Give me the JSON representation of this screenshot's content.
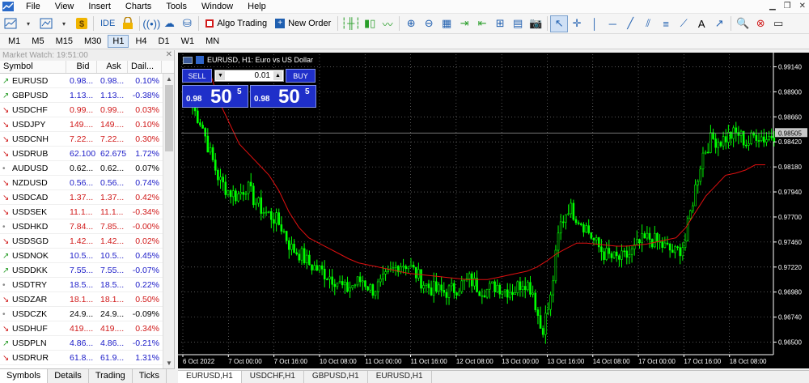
{
  "menu": [
    "File",
    "View",
    "Insert",
    "Charts",
    "Tools",
    "Window",
    "Help"
  ],
  "toolbar": {
    "ide_label": "IDE",
    "algo_label": "Algo Trading",
    "neworder_label": "New Order"
  },
  "timeframes": [
    "M1",
    "M5",
    "M15",
    "M30",
    "H1",
    "H4",
    "D1",
    "W1",
    "MN"
  ],
  "active_timeframe": "H1",
  "market_watch": {
    "title": "Market Watch: 19:51:00",
    "columns": [
      "Symbol",
      "Bid",
      "Ask",
      "Dail..."
    ],
    "rows": [
      {
        "symbol": "EURUSD",
        "bid": "0.98...",
        "ask": "0.98...",
        "daily": "0.10%",
        "dir": "up",
        "arrow": "up"
      },
      {
        "symbol": "GBPUSD",
        "bid": "1.13...",
        "ask": "1.13...",
        "daily": "-0.38%",
        "dir": "up",
        "arrow": "up"
      },
      {
        "symbol": "USDCHF",
        "bid": "0.99...",
        "ask": "0.99...",
        "daily": "0.03%",
        "dir": "down",
        "arrow": "down"
      },
      {
        "symbol": "USDJPY",
        "bid": "149....",
        "ask": "149....",
        "daily": "0.10%",
        "dir": "down",
        "arrow": "down"
      },
      {
        "symbol": "USDCNH",
        "bid": "7.22...",
        "ask": "7.22...",
        "daily": "0.30%",
        "dir": "down",
        "arrow": "down"
      },
      {
        "symbol": "USDRUB",
        "bid": "62.100",
        "ask": "62.675",
        "daily": "1.72%",
        "dir": "up",
        "arrow": "down"
      },
      {
        "symbol": "AUDUSD",
        "bid": "0.62...",
        "ask": "0.62...",
        "daily": "0.07%",
        "dir": "neutral",
        "arrow": "dot"
      },
      {
        "symbol": "NZDUSD",
        "bid": "0.56...",
        "ask": "0.56...",
        "daily": "0.74%",
        "dir": "up",
        "arrow": "down"
      },
      {
        "symbol": "USDCAD",
        "bid": "1.37...",
        "ask": "1.37...",
        "daily": "0.42%",
        "dir": "down",
        "arrow": "down"
      },
      {
        "symbol": "USDSEK",
        "bid": "11.1...",
        "ask": "11.1...",
        "daily": "-0.34%",
        "dir": "down",
        "arrow": "down"
      },
      {
        "symbol": "USDHKD",
        "bid": "7.84...",
        "ask": "7.85...",
        "daily": "-0.00%",
        "dir": "down",
        "arrow": "dot"
      },
      {
        "symbol": "USDSGD",
        "bid": "1.42...",
        "ask": "1.42...",
        "daily": "0.02%",
        "dir": "down",
        "arrow": "down"
      },
      {
        "symbol": "USDNOK",
        "bid": "10.5...",
        "ask": "10.5...",
        "daily": "0.45%",
        "dir": "up",
        "arrow": "up"
      },
      {
        "symbol": "USDDKK",
        "bid": "7.55...",
        "ask": "7.55...",
        "daily": "-0.07%",
        "dir": "up",
        "arrow": "up"
      },
      {
        "symbol": "USDTRY",
        "bid": "18.5...",
        "ask": "18.5...",
        "daily": "0.22%",
        "dir": "up",
        "arrow": "dot"
      },
      {
        "symbol": "USDZAR",
        "bid": "18.1...",
        "ask": "18.1...",
        "daily": "0.50%",
        "dir": "down",
        "arrow": "down"
      },
      {
        "symbol": "USDCZK",
        "bid": "24.9...",
        "ask": "24.9...",
        "daily": "-0.09%",
        "dir": "neutral",
        "arrow": "dot"
      },
      {
        "symbol": "USDHUF",
        "bid": "419....",
        "ask": "419....",
        "daily": "0.34%",
        "dir": "down",
        "arrow": "down"
      },
      {
        "symbol": "USDPLN",
        "bid": "4.86...",
        "ask": "4.86...",
        "daily": "-0.21%",
        "dir": "up",
        "arrow": "up"
      },
      {
        "symbol": "USDRUR",
        "bid": "61.8...",
        "ask": "61.9...",
        "daily": "1.31%",
        "dir": "up",
        "arrow": "down"
      }
    ],
    "tabs": [
      "Symbols",
      "Details",
      "Trading",
      "Ticks"
    ]
  },
  "chart": {
    "title": "EURUSD, H1:  Euro vs US Dollar",
    "sell_label": "SELL",
    "buy_label": "BUY",
    "lot": "0.01",
    "sell_small": "0.98",
    "sell_big": "50",
    "sell_sup": "5",
    "buy_small": "0.98",
    "buy_big": "50",
    "buy_sup": "5",
    "bid_tag": "0.98505",
    "bid_value": 0.98505
  },
  "chart_data": {
    "type": "candlestick",
    "symbol": "EURUSD",
    "timeframe": "H1",
    "y_ticks": [
      "0.99140",
      "0.98900",
      "0.98660",
      "0.98420",
      "0.98180",
      "0.97940",
      "0.97700",
      "0.97460",
      "0.97220",
      "0.96980",
      "0.96740",
      "0.96500"
    ],
    "ylim": [
      0.9638,
      0.9926
    ],
    "x_ticks": [
      "6 Oct 2022",
      "7 Oct 00:00",
      "7 Oct 16:00",
      "10 Oct 08:00",
      "11 Oct 00:00",
      "11 Oct 16:00",
      "12 Oct 08:00",
      "13 Oct 00:00",
      "13 Oct 16:00",
      "14 Oct 08:00",
      "17 Oct 00:00",
      "17 Oct 16:00",
      "18 Oct 08:00"
    ],
    "close_path": [
      0.9875,
      0.986,
      0.983,
      0.9805,
      0.9795,
      0.979,
      0.98,
      0.9785,
      0.9775,
      0.977,
      0.976,
      0.974,
      0.9735,
      0.9725,
      0.972,
      0.9715,
      0.971,
      0.97,
      0.9705,
      0.971,
      0.97,
      0.9705,
      0.9715,
      0.9725,
      0.9725,
      0.9715,
      0.9705,
      0.97,
      0.9698,
      0.97,
      0.9705,
      0.971,
      0.9702,
      0.97,
      0.9705,
      0.97,
      0.97,
      0.971,
      0.97,
      0.966,
      0.969,
      0.976,
      0.978,
      0.977,
      0.976,
      0.9745,
      0.9735,
      0.973,
      0.973,
      0.9735,
      0.9745,
      0.975,
      0.9745,
      0.974,
      0.9735,
      0.9745,
      0.979,
      0.983,
      0.9845,
      0.9843,
      0.9848,
      0.985,
      0.984,
      0.985,
      0.9845,
      0.985
    ],
    "ma_path": [
      0.991,
      0.988,
      0.986,
      0.984,
      0.983,
      0.982,
      0.981,
      0.9795,
      0.9775,
      0.976,
      0.975,
      0.9745,
      0.974,
      0.9735,
      0.973,
      0.9726,
      0.9724,
      0.9722,
      0.972,
      0.9718,
      0.9716,
      0.9715,
      0.9714,
      0.9713,
      0.9712,
      0.9711,
      0.971,
      0.971,
      0.971,
      0.9712,
      0.9714,
      0.9716,
      0.9718,
      0.9722,
      0.9728,
      0.9735,
      0.974,
      0.9745,
      0.9745,
      0.9744,
      0.9743,
      0.9742,
      0.9742,
      0.9743,
      0.9744,
      0.9746,
      0.9748,
      0.975,
      0.976,
      0.9775,
      0.979,
      0.98,
      0.981,
      0.9812,
      0.9815,
      0.982,
      0.982
    ],
    "colors": {
      "candle": "#00ff00",
      "ma": "#e01010",
      "grid": "#8a8a8a",
      "background": "#000000"
    }
  },
  "chart_tabs": [
    "EURUSD,H1",
    "USDCHF,H1",
    "GBPUSD,H1",
    "EURUSD,H1"
  ]
}
